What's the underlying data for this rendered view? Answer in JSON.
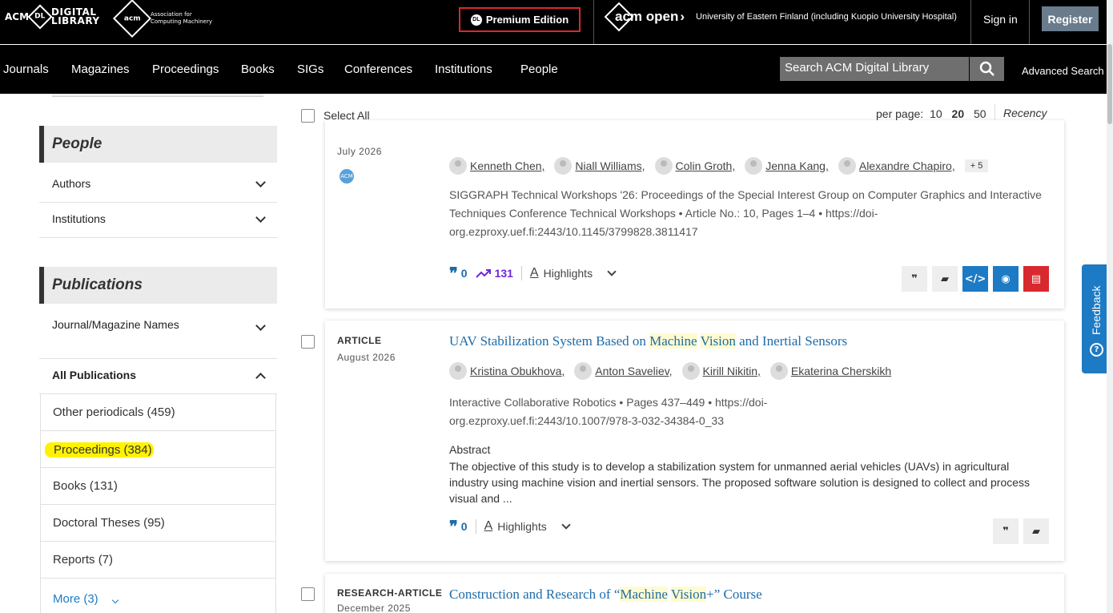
{
  "header": {
    "dl_logo": {
      "acm": "ACM",
      "mark": "DL",
      "line1": "DIGITAL",
      "line2": "LIBRARY"
    },
    "acm_logo": {
      "mark": "acm",
      "line1": "Association for",
      "line2": "Computing Machinery"
    },
    "premium_label": "Premium Edition",
    "premium_icon": "DL",
    "acm_open": "acm open",
    "institution": "University of Eastern Finland (including Kuopio University Hospital)",
    "sign_in": "Sign in",
    "register": "Register"
  },
  "nav": {
    "items": [
      "Journals",
      "Magazines",
      "Proceedings",
      "Books",
      "SIGs",
      "Conferences",
      "Institutions",
      "People"
    ],
    "search_placeholder": "Search ACM Digital Library",
    "advanced_search": "Advanced Search"
  },
  "sidebar": {
    "people_header": "People",
    "people_items": [
      "Authors",
      "Institutions"
    ],
    "publications_header": "Publications",
    "journal_names": "Journal/Magazine Names",
    "all_publications": "All Publications",
    "pub_items": [
      "Other periodicals (459)",
      "Proceedings (384)",
      "Books (131)",
      "Doctoral Theses (95)",
      "Reports (7)"
    ],
    "more": "More (3)"
  },
  "results": {
    "select_all": "Select All",
    "per_page_label": "per page:",
    "per_page_options": [
      "10",
      "20",
      "50"
    ],
    "per_page_selected": "20",
    "sort": "Recency",
    "cards": [
      {
        "date": "July 2026",
        "badge": "ACM",
        "authors": [
          "Kenneth Chen,",
          "Niall Williams,",
          "Colin Groth,",
          "Jenna Kang,",
          "Alexandre Chapiro,"
        ],
        "more_authors": "+ 5",
        "pubinfo": "SIGGRAPH Technical Workshops '26: Proceedings of the Special Interest Group on Computer Graphics and Interactive Techniques Conference Technical Workshops • Article No.: 10, Pages 1–4 • https://doi-org.ezproxy.uef.fi:2443/10.1145/3799828.3811417",
        "citations": "0",
        "downloads": "131",
        "highlights": "Highlights"
      },
      {
        "type": "ARTICLE",
        "date": "August 2026",
        "title_pre": "UAV Stabilization System Based on ",
        "title_hl1": "Machine",
        "title_hl2": "Vision",
        "title_post": " and Inertial Sensors",
        "authors": [
          "Kristina Obukhova,",
          "Anton Saveliev,",
          "Kirill Nikitin,",
          "Ekaterina Cherskikh"
        ],
        "pubinfo": "Interactive Collaborative Robotics • Pages 437–449 • https://doi-org.ezproxy.uef.fi:2443/10.1007/978-3-032-34384-0_33",
        "abstract_label": "Abstract",
        "abstract": "The objective of this study is to develop a stabilization system for unmanned aerial vehicles (UAVs) in agricultural industry using machine vision and inertial sensors. The proposed software solution is designed to collect and process visual and ...",
        "citations": "0",
        "highlights": "Highlights"
      },
      {
        "type": "RESEARCH-ARTICLE",
        "date": "December 2025",
        "title_pre": "Construction and Research of “",
        "title_hl1": "Machine",
        "title_hl2": "Vision",
        "title_post": "+” Course"
      }
    ]
  },
  "feedback": {
    "label": "Feedback",
    "icon": "?"
  },
  "colors": {
    "accent": "#1d7ac4",
    "premium_border": "#d8292f",
    "highlight": "#fff200",
    "downloads": "#6d28d9"
  }
}
